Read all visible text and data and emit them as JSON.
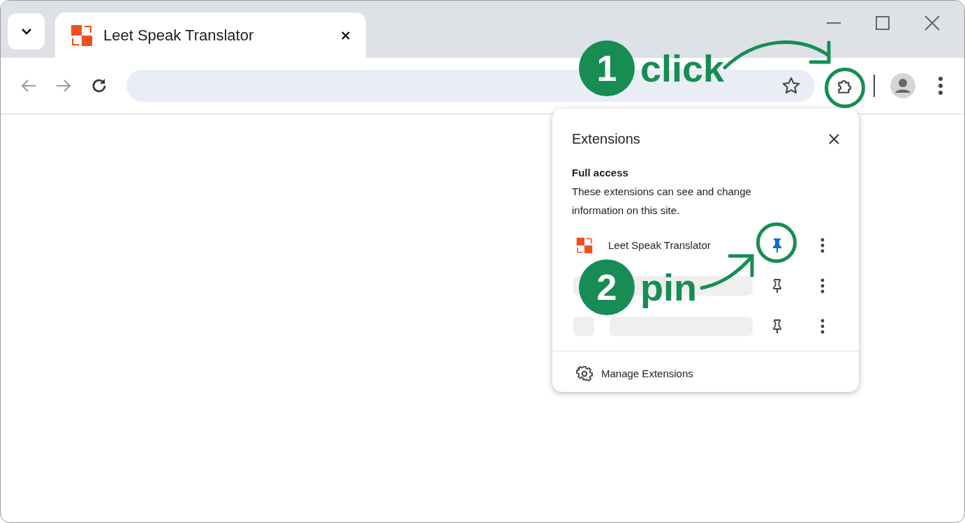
{
  "tab_strip": {
    "tabs": [
      {
        "title": "Leet Speak Translator",
        "selected": true
      }
    ]
  },
  "toolbar": {
    "back": {
      "disabled": true
    },
    "forward": {
      "disabled": true
    }
  },
  "extensions_popup": {
    "title": "Extensions",
    "section_title": "Full access",
    "section_description": "These extensions can see and change information on this site.",
    "extensions": [
      {
        "kind": "item",
        "name": "Leet Speak Translator",
        "pinned": true
      },
      {
        "kind": "placeholder",
        "pinned": false
      },
      {
        "kind": "placeholder",
        "pinned": false
      }
    ],
    "footer_link": "Manage Extensions"
  },
  "annotations": [
    {
      "number": "1",
      "label": "click"
    },
    {
      "number": "2",
      "label": "pin"
    }
  ]
}
